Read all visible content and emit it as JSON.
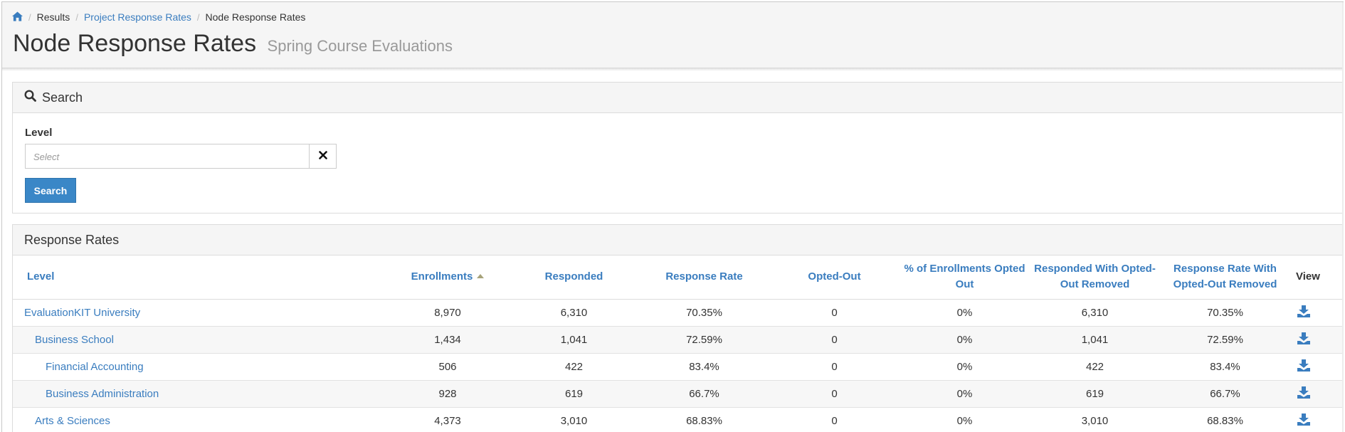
{
  "breadcrumb": {
    "home_icon": "home-icon",
    "items": [
      "Results",
      "Project Response Rates",
      "Node Response Rates"
    ]
  },
  "page": {
    "title": "Node Response Rates",
    "subtitle": "Spring Course Evaluations"
  },
  "search": {
    "heading": "Search",
    "heading_icon": "search-icon",
    "level_label": "Level",
    "level_placeholder": "Select",
    "clear_icon": "close-icon",
    "button_label": "Search"
  },
  "response_rates": {
    "heading": "Response Rates",
    "columns": [
      "Level",
      "Enrollments",
      "Responded",
      "Response Rate",
      "Opted-Out",
      "% of Enrollments Opted Out",
      "Responded With Opted-Out Removed",
      "Response Rate With Opted-Out Removed",
      "View"
    ],
    "rows": [
      {
        "level": "EvaluationKIT University",
        "indent": 0,
        "enrollments": "8,970",
        "responded": "6,310",
        "rate": "70.35%",
        "opted_out": "0",
        "pct_opted_out": "0%",
        "responded_removed": "6,310",
        "rate_removed": "70.35%"
      },
      {
        "level": "Business School",
        "indent": 1,
        "enrollments": "1,434",
        "responded": "1,041",
        "rate": "72.59%",
        "opted_out": "0",
        "pct_opted_out": "0%",
        "responded_removed": "1,041",
        "rate_removed": "72.59%"
      },
      {
        "level": "Financial Accounting",
        "indent": 2,
        "enrollments": "506",
        "responded": "422",
        "rate": "83.4%",
        "opted_out": "0",
        "pct_opted_out": "0%",
        "responded_removed": "422",
        "rate_removed": "83.4%"
      },
      {
        "level": "Business Administration",
        "indent": 2,
        "enrollments": "928",
        "responded": "619",
        "rate": "66.7%",
        "opted_out": "0",
        "pct_opted_out": "0%",
        "responded_removed": "619",
        "rate_removed": "66.7%"
      },
      {
        "level": "Arts & Sciences",
        "indent": 1,
        "enrollments": "4,373",
        "responded": "3,010",
        "rate": "68.83%",
        "opted_out": "0",
        "pct_opted_out": "0%",
        "responded_removed": "3,010",
        "rate_removed": "68.83%"
      }
    ],
    "download_icon": "download-icon"
  },
  "colors": {
    "link": "#3a7dbf",
    "primary_button": "#3a87c7",
    "header_bg": "#f5f5f5"
  }
}
